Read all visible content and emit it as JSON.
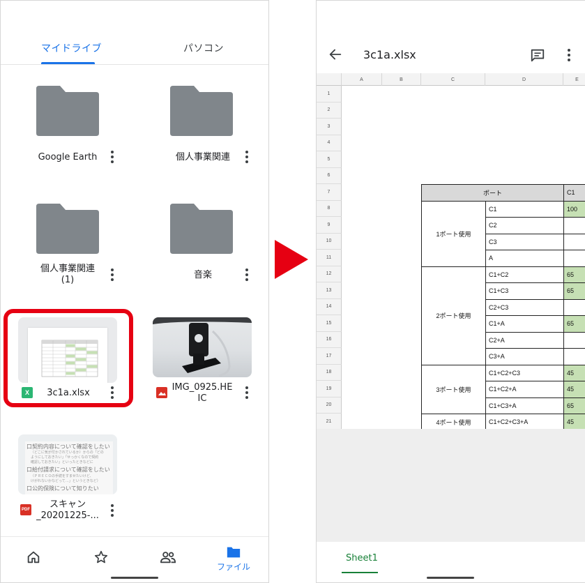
{
  "drive": {
    "tabs": [
      "マイドライブ",
      "パソコン"
    ],
    "items": [
      {
        "name": "Google Earth",
        "type": "folder"
      },
      {
        "name": "個人事業関連",
        "type": "folder"
      },
      {
        "name": "個人事業関連\n(1)",
        "type": "folder"
      },
      {
        "name": "音楽",
        "type": "folder"
      },
      {
        "name": "3c1a.xlsx",
        "type": "xlsx",
        "badge": "X"
      },
      {
        "name": "IMG_0925.HE\nIC",
        "type": "image"
      },
      {
        "name": "スキャン\n_20201225-...",
        "type": "pdf",
        "badge": "PDF"
      }
    ],
    "scan_preview_lines": [
      "口契約内容について確認をしたい",
      "（どこに気が付かされているか）からの「どの",
      "ようにしておきたい」「せっかくなので契約",
      "確認しておきたい」といったときなどに",
      "口給付請求について確認をしたい",
      "（ＰＲＥＣＯの手続をすませたいけど、",
      "けがれないかなどって…」というときなど）",
      "口公的保険について知りたい"
    ],
    "bottom_nav": [
      {
        "icon": "home-icon",
        "label": ""
      },
      {
        "icon": "star-icon",
        "label": ""
      },
      {
        "icon": "shared-icon",
        "label": ""
      },
      {
        "icon": "folder-icon",
        "label": "ファイル"
      }
    ],
    "accent": "#1a73e8",
    "highlight_color": "#e60012"
  },
  "sheets": {
    "title": "3c1a.xlsx",
    "columns": [
      "A",
      "B",
      "C",
      "D",
      "E"
    ],
    "rows": [
      "1",
      "2",
      "3",
      "4",
      "5",
      "6",
      "7",
      "8",
      "9",
      "10",
      "11",
      "12",
      "13",
      "14",
      "15",
      "16",
      "17",
      "18",
      "19",
      "20",
      "21"
    ],
    "table": {
      "header_port": "ポート",
      "header_c": "C1",
      "groups": [
        {
          "label": "1ポート使用",
          "rows": [
            {
              "port": "C1",
              "value": "100"
            },
            {
              "port": "C2",
              "value": ""
            },
            {
              "port": "C3",
              "value": ""
            },
            {
              "port": "A",
              "value": ""
            }
          ]
        },
        {
          "label": "2ポート使用",
          "rows": [
            {
              "port": "C1+C2",
              "value": "65"
            },
            {
              "port": "C1+C3",
              "value": "65"
            },
            {
              "port": "C2+C3",
              "value": ""
            },
            {
              "port": "C1+A",
              "value": "65"
            },
            {
              "port": "C2+A",
              "value": ""
            },
            {
              "port": "C3+A",
              "value": ""
            }
          ]
        },
        {
          "label": "3ポート使用",
          "rows": [
            {
              "port": "C1+C2+C3",
              "value": "45"
            },
            {
              "port": "C1+C2+A",
              "value": "45"
            },
            {
              "port": "C1+C3+A",
              "value": "65"
            }
          ]
        },
        {
          "label": "4ポート使用",
          "rows": [
            {
              "port": "C1+C2+C3+A",
              "value": "45"
            }
          ]
        }
      ]
    },
    "sheet_tab": "Sheet1",
    "accent": "#188038",
    "value_fill": "#c6e0b4"
  }
}
